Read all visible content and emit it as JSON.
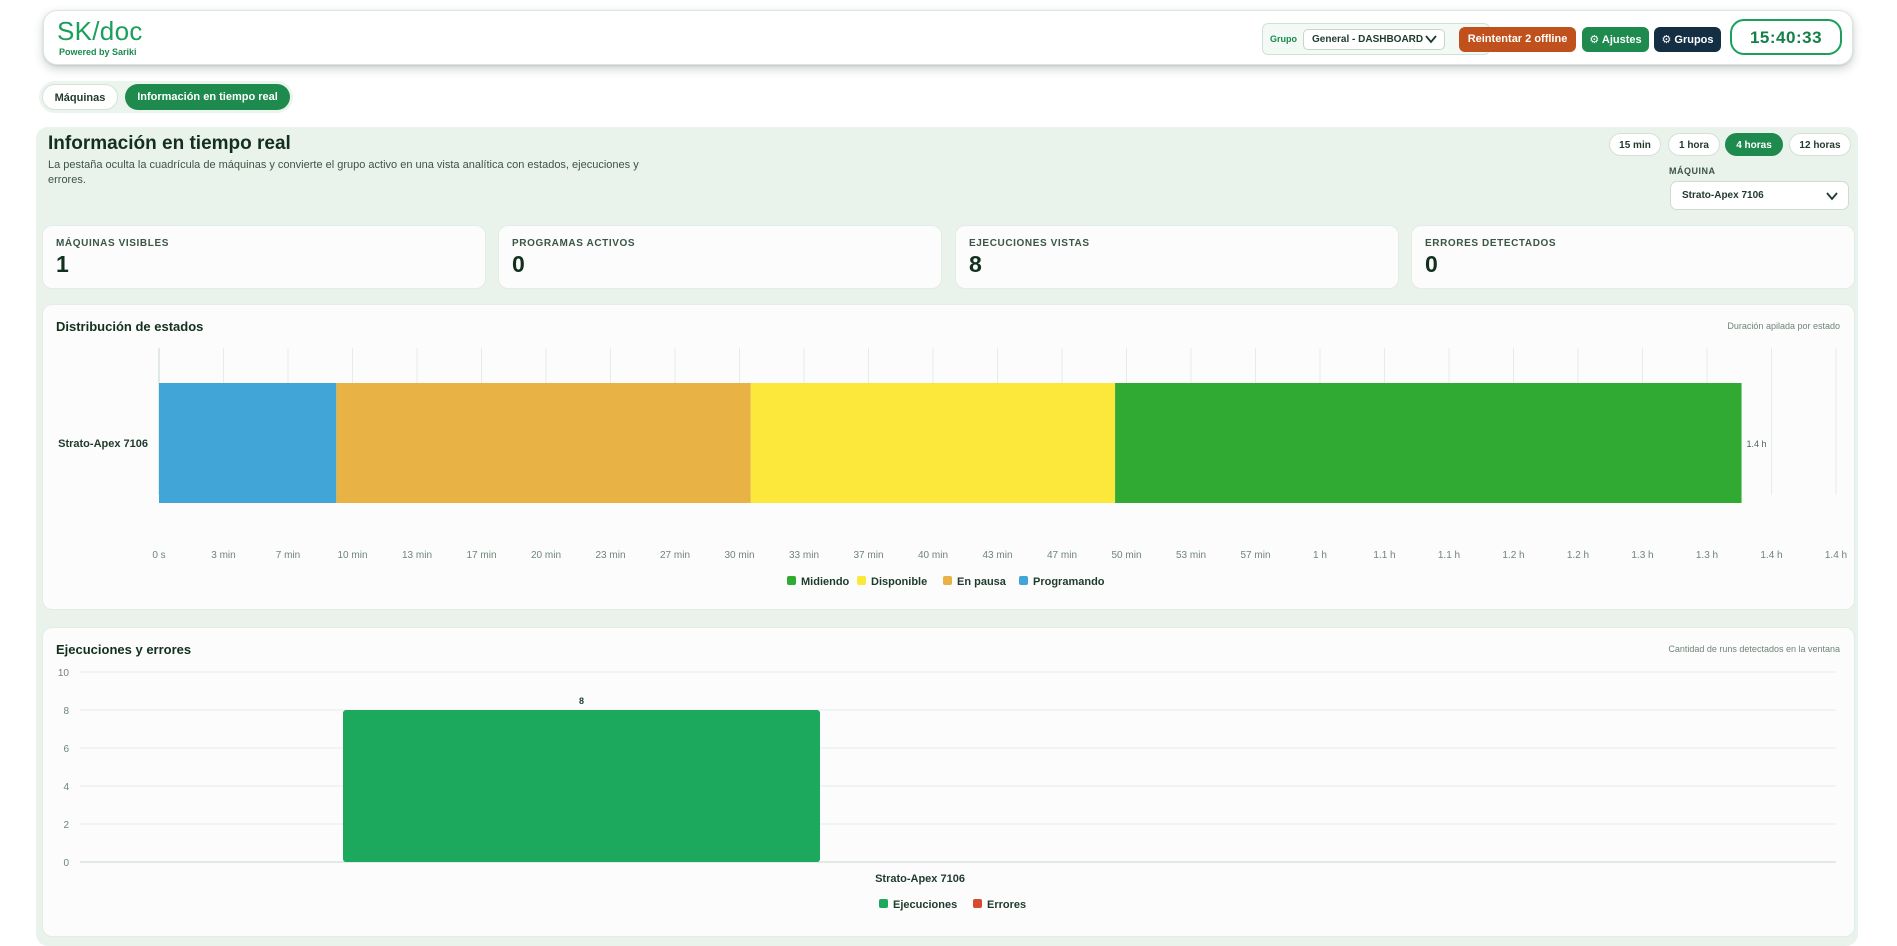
{
  "header": {
    "brand": "SK/doc",
    "powered": "Powered by Sariki",
    "grupo_label": "Grupo",
    "grupo_value": "General - DASHBOARD",
    "retry_label": "Reintentar 2 offline",
    "ajustes_label": "⚙ Ajustes",
    "grupos_label": "⚙ Grupos",
    "clock": "15:40:33"
  },
  "tabs": [
    {
      "label": "Máquinas",
      "active": false
    },
    {
      "label": "Información en tiempo real",
      "active": true
    }
  ],
  "page": {
    "title": "Información en tiempo real",
    "description": "La pestaña oculta la cuadrícula de máquinas y convierte el grupo activo en una vista analítica con estados, ejecuciones y errores."
  },
  "ranges": [
    "15 min",
    "1 hora",
    "4 horas",
    "12 horas"
  ],
  "active_range": "4 horas",
  "machine_filter": {
    "label": "MÁQUINA",
    "value": "Strato-Apex 7106"
  },
  "kpis": [
    {
      "label": "MÁQUINAS VISIBLES",
      "value": "1"
    },
    {
      "label": "PROGRAMAS ACTIVOS",
      "value": "0"
    },
    {
      "label": "EJECUCIONES VISTAS",
      "value": "8"
    },
    {
      "label": "ERRORES DETECTADOS",
      "value": "0"
    }
  ],
  "icons": {
    "chevron": "chevron-down-icon",
    "gear": "gear-icon"
  },
  "colors": {
    "accent": "#1f8a4e",
    "retry": "#c0501c",
    "grupos": "#142f44"
  },
  "chart_data": [
    {
      "type": "bar",
      "orientation": "horizontal-stacked",
      "title": "Distribución de estados",
      "note": "Duración apilada por estado",
      "categories": [
        "Strato-Apex 7106"
      ],
      "total_label": "1.4 h",
      "x_ticks": [
        "0 s",
        "3 min",
        "7 min",
        "10 min",
        "13 min",
        "17 min",
        "20 min",
        "23 min",
        "27 min",
        "30 min",
        "33 min",
        "37 min",
        "40 min",
        "43 min",
        "47 min",
        "50 min",
        "53 min",
        "57 min",
        "1 h",
        "1.1 h",
        "1.1 h",
        "1.2 h",
        "1.2 h",
        "1.3 h",
        "1.3 h",
        "1.4 h",
        "1.4 h"
      ],
      "xlim_minutes": [
        0,
        87
      ],
      "series": [
        {
          "name": "Programando",
          "color": "#42a5d8",
          "values_minutes": [
            9.2
          ]
        },
        {
          "name": "En pausa",
          "color": "#e8b245",
          "values_minutes": [
            21.5
          ]
        },
        {
          "name": "Disponible",
          "color": "#fce83a",
          "values_minutes": [
            18.9
          ]
        },
        {
          "name": "Midiendo",
          "color": "#31aa33",
          "values_minutes": [
            32.5
          ]
        }
      ],
      "legend": [
        "Midiendo",
        "Disponible",
        "En pausa",
        "Programando"
      ],
      "legend_placement": "bottom",
      "grid": true
    },
    {
      "type": "bar",
      "title": "Ejecuciones y errores",
      "note": "Cantidad de runs detectados en la ventana",
      "categories": [
        "Strato-Apex 7106"
      ],
      "series": [
        {
          "name": "Ejecuciones",
          "color": "#1ca85d",
          "values": [
            8
          ]
        },
        {
          "name": "Errores",
          "color": "#d84a30",
          "values": [
            0
          ]
        }
      ],
      "data_labels": [
        "8"
      ],
      "y_ticks": [
        0,
        2,
        4,
        6,
        8,
        10
      ],
      "ylim": [
        0,
        10
      ],
      "legend_placement": "bottom",
      "grid": true
    }
  ]
}
